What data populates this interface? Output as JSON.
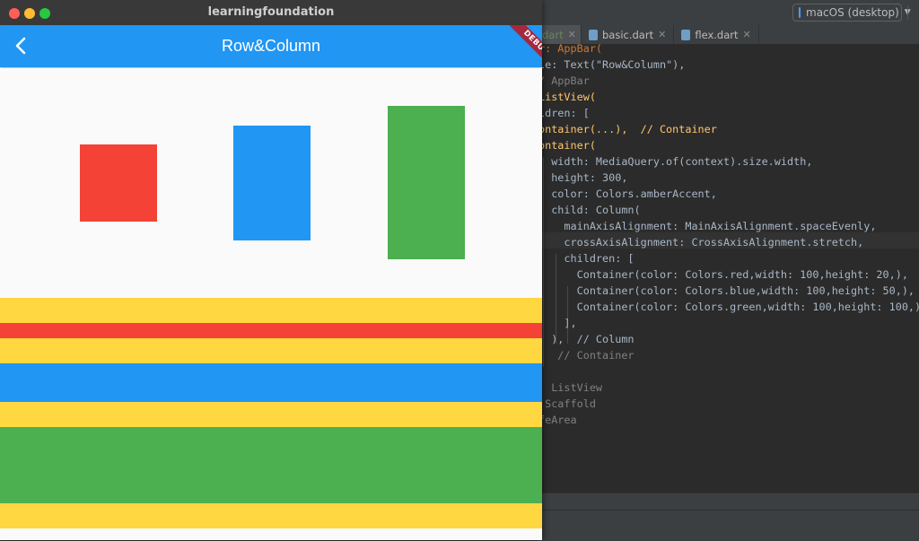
{
  "window": {
    "title": "learningfoundation"
  },
  "app": {
    "title": "Row&Column",
    "debug_banner": "DEBUG"
  },
  "colors": {
    "primary": "#2196f3",
    "red": "#f44336",
    "blue": "#2196f3",
    "green": "#4caf50",
    "amber": "#ffd740"
  },
  "ide": {
    "device_selector": "macOS (desktop)",
    "tabs": [
      {
        "label": "dart",
        "active": true
      },
      {
        "label": "basic.dart",
        "active": false
      },
      {
        "label": "flex.dart",
        "active": false
      }
    ],
    "code_lines": [
      "r: AppBar(",
      "le: Text(\"Row&Column\"),",
      "/ AppBar",
      "ListView(",
      "ldren: [",
      "ontainer(...),  // Container",
      "ontainer(",
      "  width: MediaQuery.of(context).size.width,",
      "  height: 300,",
      "  color: Colors.amberAccent,",
      "  child: Column(",
      "    mainAxisAlignment: MainAxisAlignment.spaceEvenly,",
      "    crossAxisAlignment: CrossAxisAlignment.stretch,",
      "    children: [",
      "      Container(color: Colors.red,width: 100,height: 20,),",
      "      Container(color: Colors.blue,width: 100,height: 50,),",
      "      Container(color: Colors.green,width: 100,height: 100,),",
      "    ],",
      "  ),  // Column",
      "   // Container",
      "",
      "  ListView",
      " Scaffold",
      "feArea"
    ]
  }
}
